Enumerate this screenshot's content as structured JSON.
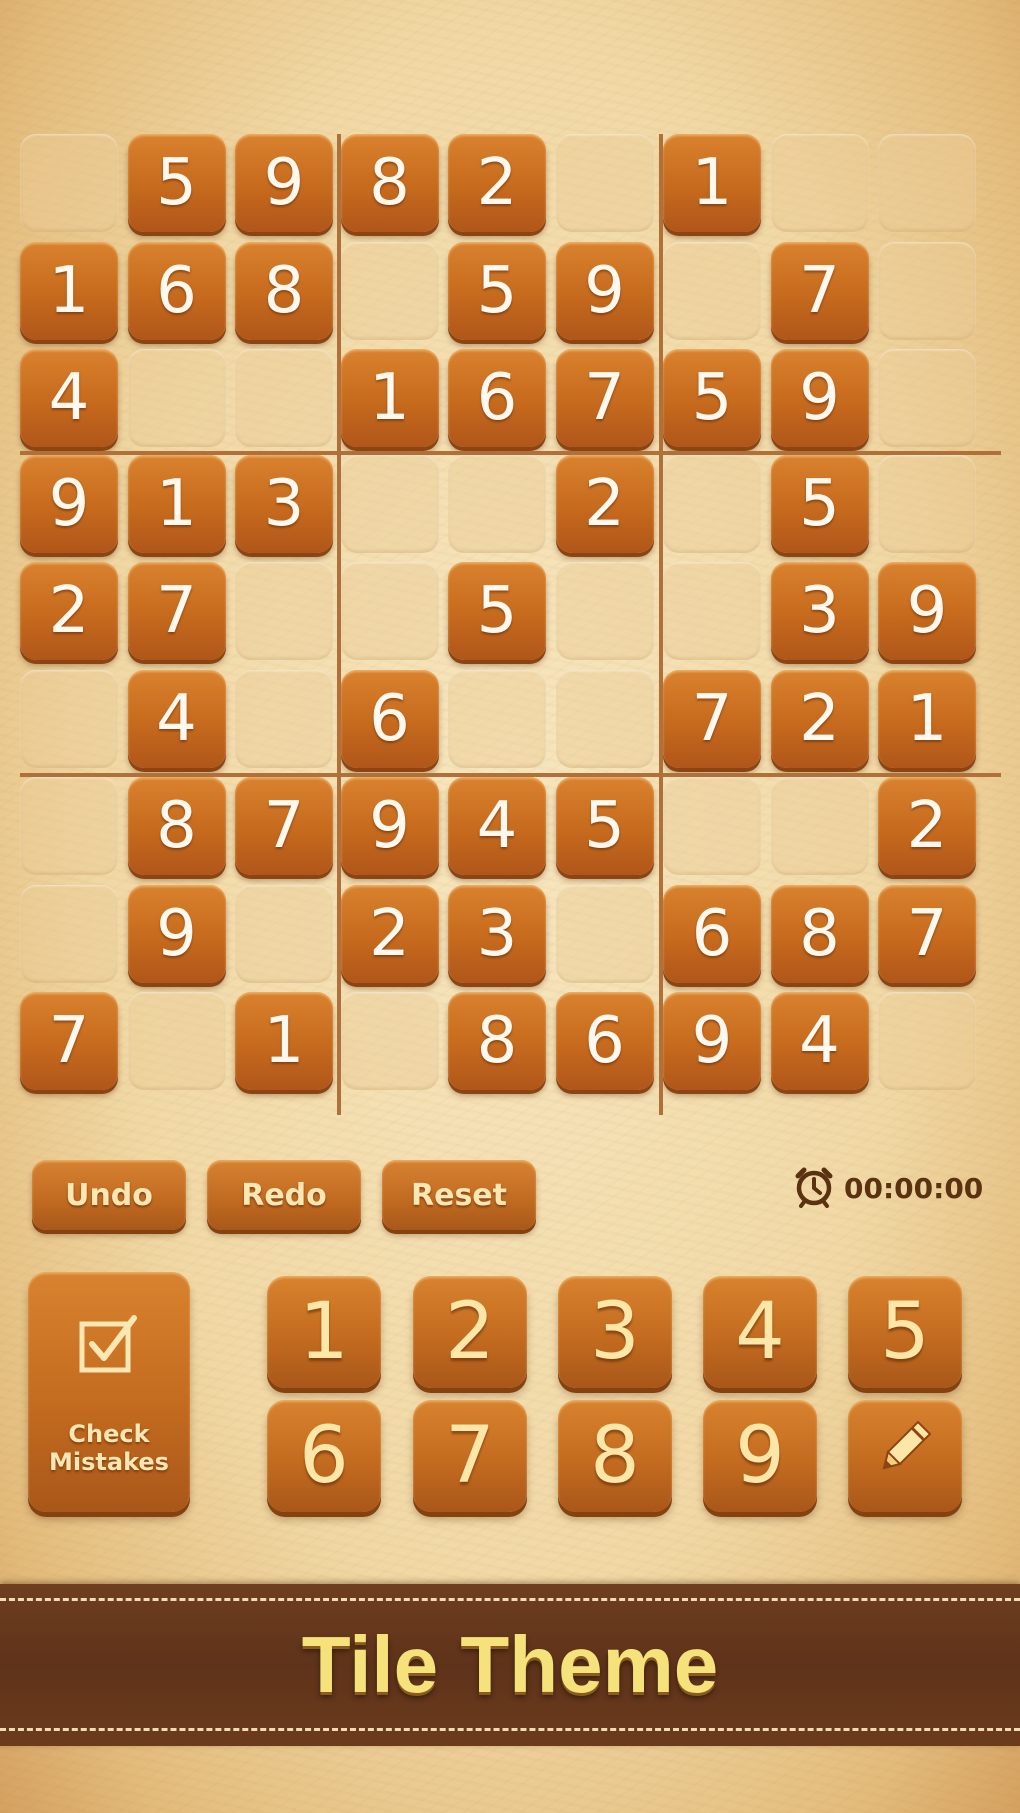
{
  "board": {
    "rows": [
      [
        "",
        "5",
        "9",
        "8",
        "2",
        "",
        "1",
        "",
        ""
      ],
      [
        "1",
        "6",
        "8",
        "",
        "5",
        "9",
        "",
        "7",
        ""
      ],
      [
        "4",
        "",
        "",
        "1",
        "6",
        "7",
        "5",
        "9",
        ""
      ],
      [
        "9",
        "1",
        "3",
        "",
        "",
        "2",
        "",
        "5",
        ""
      ],
      [
        "2",
        "7",
        "",
        "",
        "5",
        "",
        "",
        "3",
        "9"
      ],
      [
        "",
        "4",
        "",
        "6",
        "",
        "",
        "7",
        "2",
        "1"
      ],
      [
        "",
        "8",
        "7",
        "9",
        "4",
        "5",
        "",
        "",
        "2"
      ],
      [
        "",
        "9",
        "",
        "2",
        "3",
        "",
        "6",
        "8",
        "7"
      ],
      [
        "7",
        "",
        "1",
        "",
        "8",
        "6",
        "9",
        "4",
        ""
      ]
    ]
  },
  "actions": {
    "undo_label": "Undo",
    "redo_label": "Redo",
    "reset_label": "Reset"
  },
  "timer": {
    "value": "00:00:00",
    "icon": "alarm-clock-icon"
  },
  "check_mistakes": {
    "label_line1": "Check",
    "label_line2": "Mistakes",
    "icon": "checkbox-icon"
  },
  "number_pad": {
    "keys": [
      "1",
      "2",
      "3",
      "4",
      "5",
      "6",
      "7",
      "8",
      "9"
    ],
    "pencil_icon": "pencil-icon"
  },
  "banner": {
    "title": "Tile Theme"
  },
  "colors": {
    "tile": "#c66a1d",
    "tile_text": "#fff8ee",
    "pad_text": "#fde7a8",
    "banner_bg": "#5f331a",
    "banner_text": "#f6e27a"
  }
}
